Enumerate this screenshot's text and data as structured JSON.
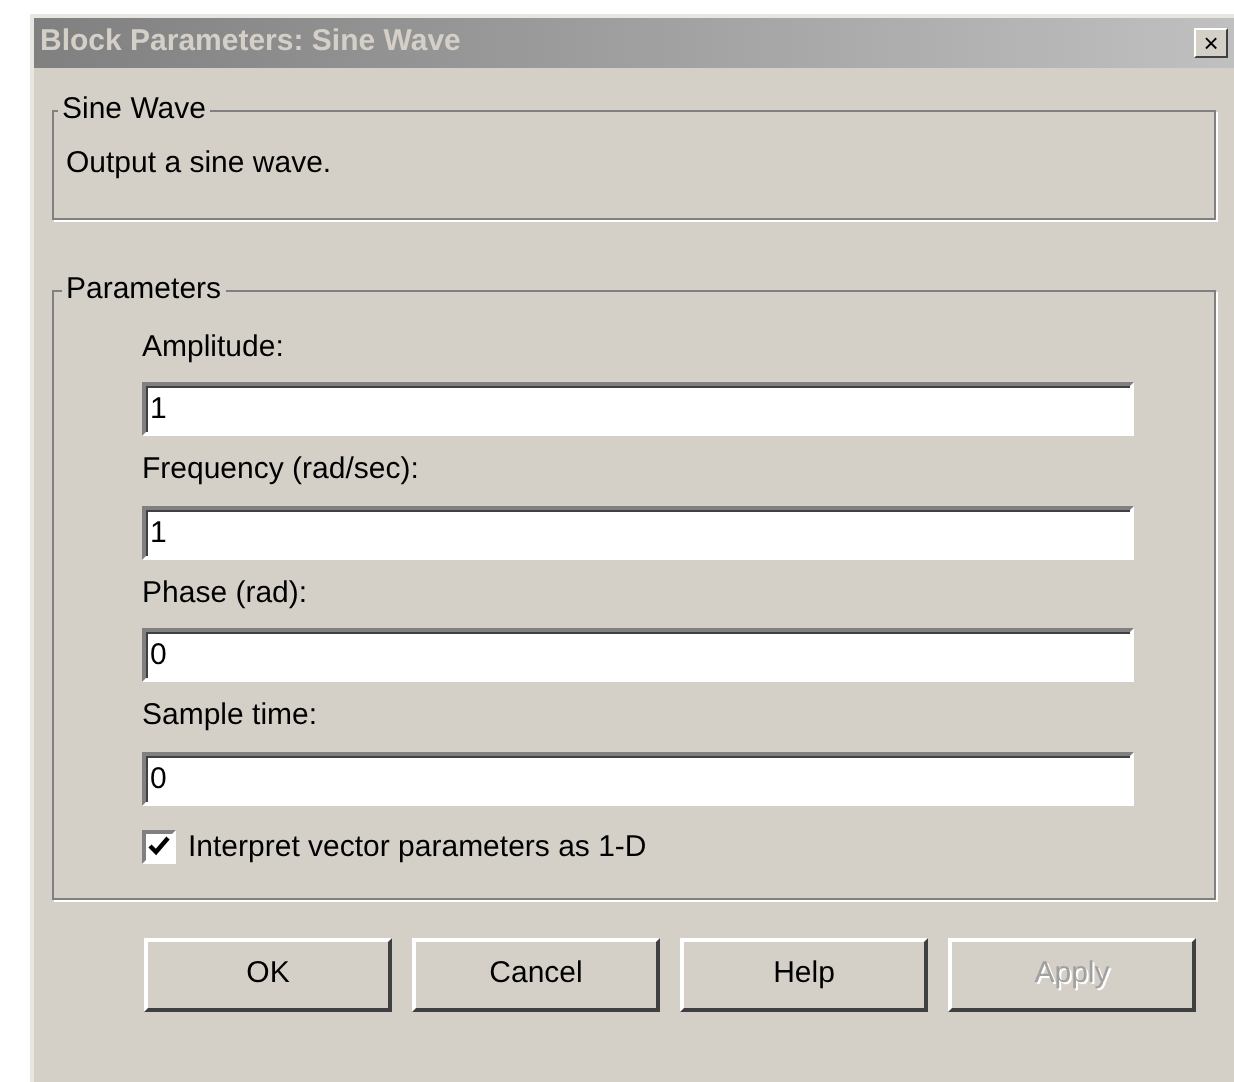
{
  "window": {
    "title": "Block Parameters: Sine Wave",
    "close": "×"
  },
  "description_group": {
    "title": "Sine Wave",
    "text": "Output a sine wave."
  },
  "parameters_group": {
    "title": "Parameters",
    "fields": [
      {
        "label": "Amplitude:",
        "value": "1"
      },
      {
        "label": "Frequency (rad/sec):",
        "value": "1"
      },
      {
        "label": "Phase (rad):",
        "value": "0"
      },
      {
        "label": "Sample time:",
        "value": "0"
      }
    ],
    "checkbox": {
      "label": "Interpret vector parameters as 1-D",
      "checked": true
    }
  },
  "buttons": [
    {
      "label": "OK",
      "disabled": false
    },
    {
      "label": "Cancel",
      "disabled": false
    },
    {
      "label": "Help",
      "disabled": false
    },
    {
      "label": "Apply",
      "disabled": true
    }
  ]
}
